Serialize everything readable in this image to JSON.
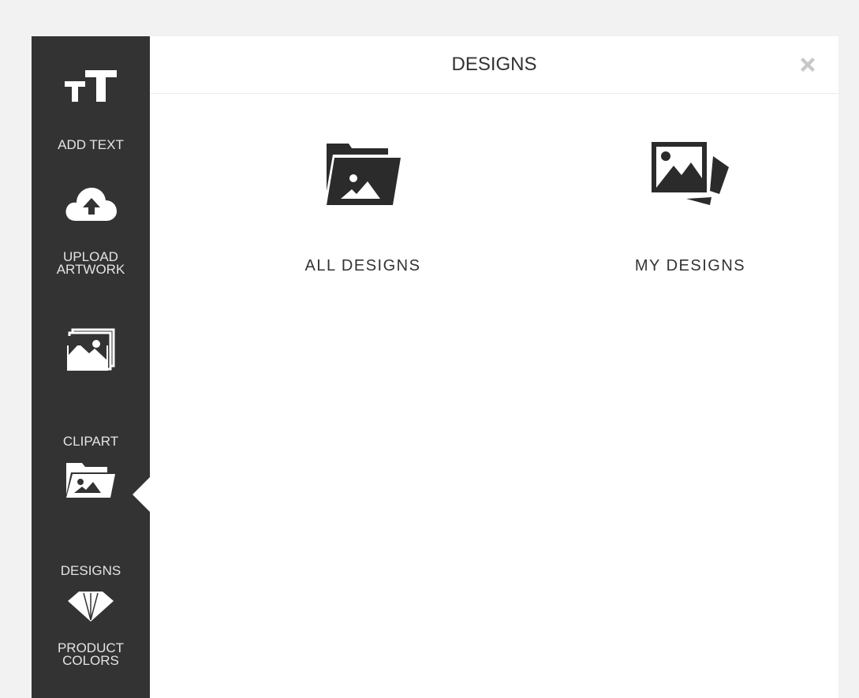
{
  "sidebar": {
    "items": [
      {
        "label": "ADD TEXT",
        "icon": "text-size-icon"
      },
      {
        "label": "UPLOAD\nARTWORK",
        "icon": "cloud-upload-icon"
      },
      {
        "label": "CLIPART",
        "icon": "images-icon"
      },
      {
        "label": "DESIGNS",
        "icon": "folder-image-icon",
        "active": true
      },
      {
        "label": "PRODUCT\nCOLORS",
        "icon": "color-swatch-icon"
      }
    ]
  },
  "panel": {
    "title": "DESIGNS",
    "close_icon": "close-icon",
    "tiles": [
      {
        "label": "ALL DESIGNS",
        "icon": "folder-image-icon"
      },
      {
        "label": "MY DESIGNS",
        "icon": "image-stack-icon"
      }
    ]
  },
  "colors": {
    "sidebar_bg": "#333333",
    "sidebar_text": "#e4e4e4",
    "panel_bg": "#ffffff",
    "page_bg": "#f2f2f2",
    "icon_dark": "#2b2b2b",
    "close_icon": "#c8c8c8"
  }
}
